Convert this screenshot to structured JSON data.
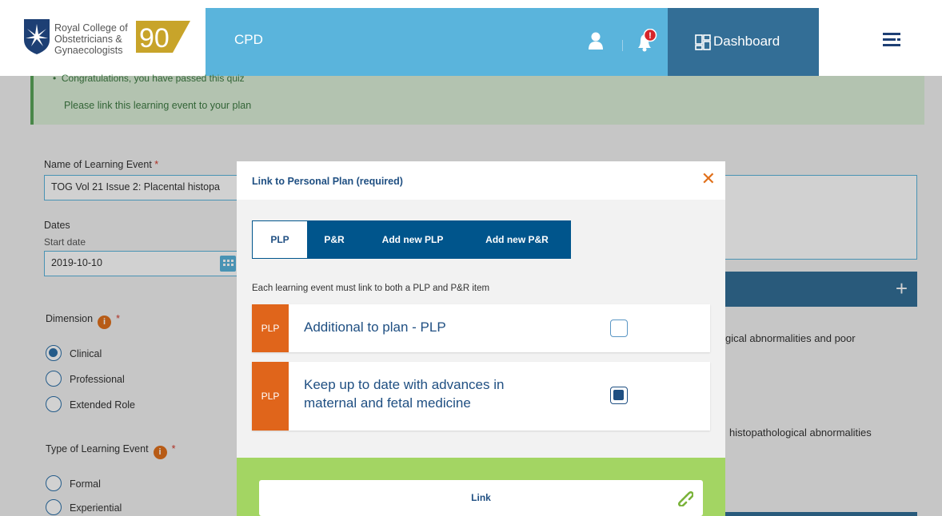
{
  "header": {
    "logo_lines": [
      "Royal College of",
      "Obstetricians &",
      "Gynaecologists"
    ],
    "logo_number": "90",
    "section_title": "CPD",
    "notification_count": "!",
    "dashboard_label": "Dashboard"
  },
  "alert": {
    "line1": "Congratulations, you have passed this quiz",
    "line2": "Please link this learning event to your plan"
  },
  "form": {
    "name_label": "Name of Learning Event",
    "name_value": "TOG Vol 21 Issue 2: Placental histopa",
    "dates_label": "Dates",
    "start_date_label": "Start date",
    "start_date_value": "2019-10-10",
    "dimension_label": "Dimension",
    "dimension_options": [
      "Clinical",
      "Professional",
      "Extended Role"
    ],
    "dimension_selected": "Clinical",
    "type_label": "Type of Learning Event",
    "type_options": [
      "Formal",
      "Experiential"
    ],
    "required_mark": "*",
    "info_glyph": "i"
  },
  "right_panel": {
    "add_glyph": "+",
    "text1": "gical abnormalities and poor",
    "text2": "histopathological abnormalities"
  },
  "modal": {
    "title": "Link to Personal Plan (required)",
    "close_glyph": "✕",
    "tabs": [
      "PLP",
      "P&R",
      "Add new PLP",
      "Add new P&R"
    ],
    "active_tab": "PLP",
    "hint": "Each learning event must link to both a PLP and P&R item",
    "items": [
      {
        "tag": "PLP",
        "text": "Additional to plan - PLP",
        "checked": false
      },
      {
        "tag": "PLP",
        "text_line1": "Keep up to date with advances in",
        "text_line2": "maternal and fetal medicine",
        "checked": true
      }
    ],
    "link_button": "Link"
  },
  "colors": {
    "cpd_blue": "#5ab4dc",
    "dashboard_blue": "#336e96",
    "tab_navy": "#00558c",
    "orange": "#e0651b",
    "footer_green": "#a3d563"
  }
}
